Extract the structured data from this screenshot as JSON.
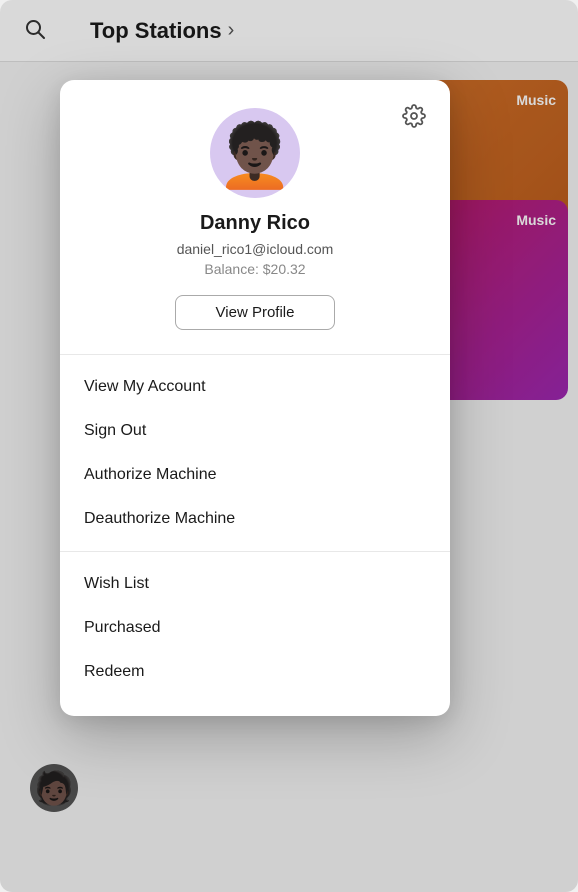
{
  "app": {
    "title": "Top Stations",
    "title_chevron": "›"
  },
  "header": {
    "search_icon": "🔍"
  },
  "user": {
    "name": "Danny Rico",
    "email": "daniel_rico1@icloud.com",
    "balance_label": "Balance: $20.32",
    "view_profile_label": "View Profile"
  },
  "menu": {
    "section1": [
      {
        "label": "View My Account"
      },
      {
        "label": "Sign Out"
      },
      {
        "label": "Authorize Machine"
      },
      {
        "label": "Deauthorize Machine"
      }
    ],
    "section2": [
      {
        "label": "Wish List"
      },
      {
        "label": "Purchased"
      },
      {
        "label": "Redeem"
      }
    ]
  },
  "background": {
    "card_top_label": "Music",
    "card_bottom_label": "Music"
  },
  "icons": {
    "gear": "⚙",
    "search": "⌕",
    "chevron_right": "›"
  }
}
